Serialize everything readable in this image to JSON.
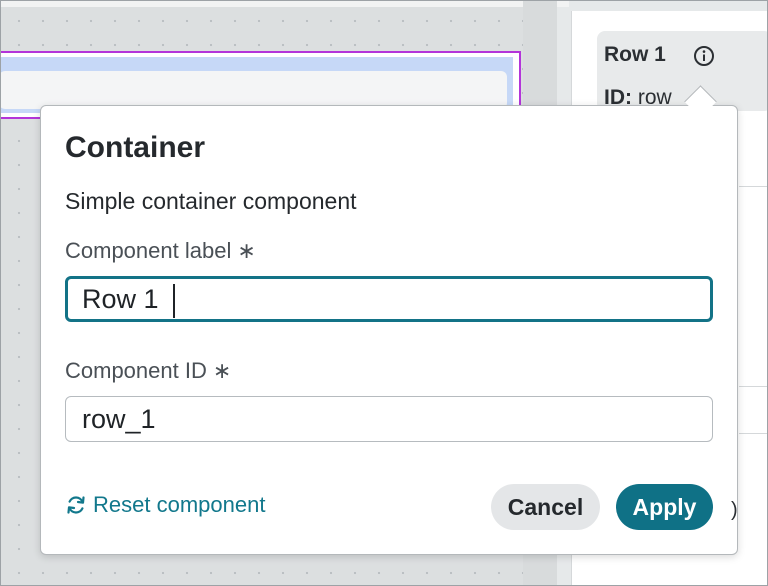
{
  "panel": {
    "title": "Row 1",
    "id_label": "ID:",
    "id_value": "row"
  },
  "popover": {
    "title": "Container",
    "description": "Simple container component",
    "label_field": {
      "label": "Component label",
      "required_mark": "∗",
      "value": "Row 1"
    },
    "id_field": {
      "label": "Component ID",
      "required_mark": "∗",
      "value": "row_1"
    },
    "reset_label": "Reset component",
    "cancel_label": "Cancel",
    "apply_label": "Apply"
  },
  "colors": {
    "accent": "#0f7186",
    "selection_outline": "#b335d9"
  },
  "icons": {
    "info": "info-icon",
    "reset": "refresh-icon"
  }
}
